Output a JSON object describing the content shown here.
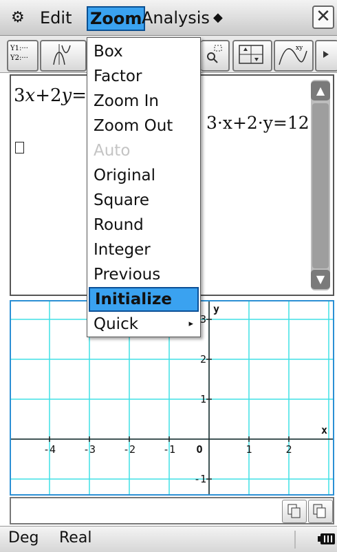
{
  "menubar": {
    "settings_icon": "gear-icon",
    "edit": "Edit",
    "zoom": "Zoom",
    "analysis": "Analysis",
    "diamond": "◆",
    "close_icon": "close-icon",
    "close_glyph": "✕"
  },
  "toolbar": {
    "y1": "Y1:···",
    "y2": "Y2:···",
    "more_icon": "triangle-right-icon"
  },
  "editor": {
    "input_left": "3",
    "input_x": "x",
    "input_mid": "+2",
    "input_y": "y",
    "input_eq": "=",
    "result": "3·x+2·y=12"
  },
  "menu": {
    "items": [
      {
        "label": "Box",
        "state": "enabled"
      },
      {
        "label": "Factor",
        "state": "enabled"
      },
      {
        "label": "Zoom In",
        "state": "enabled"
      },
      {
        "label": "Zoom Out",
        "state": "enabled"
      },
      {
        "label": "Auto",
        "state": "disabled"
      },
      {
        "label": "Original",
        "state": "enabled"
      },
      {
        "label": "Square",
        "state": "enabled"
      },
      {
        "label": "Round",
        "state": "enabled"
      },
      {
        "label": "Integer",
        "state": "enabled"
      },
      {
        "label": "Previous",
        "state": "enabled"
      },
      {
        "label": "Initialize",
        "state": "selected"
      },
      {
        "label": "Quick",
        "state": "submenu"
      }
    ],
    "submenu_arrow": "▸"
  },
  "graph": {
    "x_ticks": [
      "-4",
      "-3",
      "-2",
      "-1",
      "O",
      "1",
      "2"
    ],
    "y_ticks": [
      "3",
      "2",
      "1",
      "-1"
    ],
    "x_axis_label": "x",
    "y_axis_label": "y",
    "grid_color": "#3fe0e6"
  },
  "status": {
    "angle": "Deg",
    "mode": "Real",
    "battery_icon": "battery-icon"
  },
  "colors": {
    "accent": "#3aa2f0",
    "graph_border": "#2b8fd4"
  }
}
